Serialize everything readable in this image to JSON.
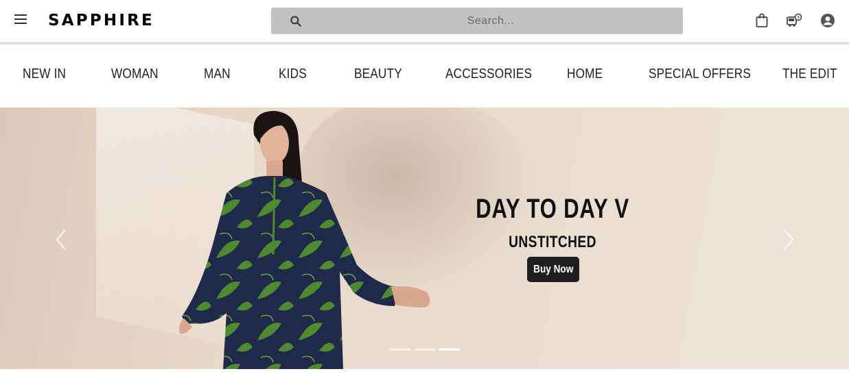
{
  "header": {
    "logo": "SAPPHIRE",
    "search": {
      "placeholder": "Search..."
    },
    "icons": [
      "menu-icon",
      "search-icon",
      "shopping-bag-icon",
      "delivery-truck-icon",
      "account-icon"
    ]
  },
  "nav": {
    "items": [
      {
        "label": "NEW IN"
      },
      {
        "label": "WOMAN"
      },
      {
        "label": "MAN"
      },
      {
        "label": "KIDS"
      },
      {
        "label": "BEAUTY"
      },
      {
        "label": "ACCESSORIES"
      },
      {
        "label": "HOME"
      },
      {
        "label": "SPECIAL OFFERS"
      },
      {
        "label": "THE EDIT"
      }
    ]
  },
  "hero": {
    "title": "DAY TO DAY V",
    "subtitle": "UNSTITCHED",
    "cta": "Buy Now",
    "slide_count": 3,
    "active_slide": 3
  },
  "colors": {
    "search_bg": "#c2c2c2",
    "button_bg": "#1f1f22",
    "dress_navy": "#1f2a4a",
    "dress_green": "#4f8a2e"
  }
}
